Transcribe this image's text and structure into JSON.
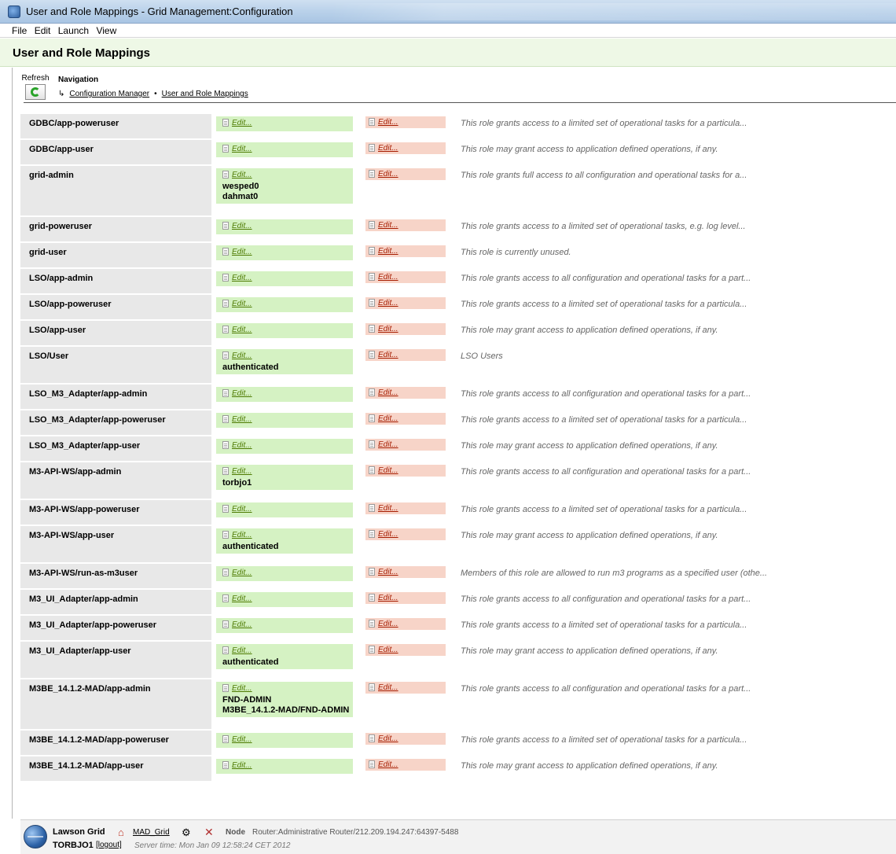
{
  "window": {
    "title": "User and Role Mappings - Grid Management:Configuration",
    "icon": "grid-app-icon"
  },
  "menu": [
    "File",
    "Edit",
    "Launch",
    "View"
  ],
  "header": {
    "title": "User and Role Mappings"
  },
  "toolbar": {
    "refresh_label": "Refresh",
    "refresh_icon": "refresh-icon"
  },
  "navigation": {
    "title": "Navigation",
    "arrow": "↳",
    "separator": "•",
    "crumbs": [
      "Configuration Manager",
      "User and Role Mappings"
    ]
  },
  "edit_label": "Edit...",
  "colors": {
    "users_bg": "#d5f2c3",
    "groups_bg": "#f7d4c8",
    "role_bg": "#e8e8e8",
    "header_bg": "#eef8e6"
  },
  "roles": [
    {
      "name": "GDBC/app-poweruser",
      "users": [],
      "desc": "This role grants access to a limited set of operational tasks for a particula..."
    },
    {
      "name": "GDBC/app-user",
      "users": [],
      "desc": "This role may grant access to application defined operations, if any."
    },
    {
      "name": "grid-admin",
      "users": [
        "wesped0",
        "dahmat0"
      ],
      "desc": "This role grants full access to all configuration and operational tasks for a..."
    },
    {
      "name": "grid-poweruser",
      "users": [],
      "desc": "This role grants access to a limited set of operational tasks, e.g. log level..."
    },
    {
      "name": "grid-user",
      "users": [],
      "desc": "This role is currently unused."
    },
    {
      "name": "LSO/app-admin",
      "users": [],
      "desc": "This role grants access to all configuration and operational tasks for a part..."
    },
    {
      "name": "LSO/app-poweruser",
      "users": [],
      "desc": "This role grants access to a limited set of operational tasks for a particula..."
    },
    {
      "name": "LSO/app-user",
      "users": [],
      "desc": "This role may grant access to application defined operations, if any."
    },
    {
      "name": "LSO/User",
      "users": [
        "authenticated"
      ],
      "desc": "LSO Users"
    },
    {
      "name": "LSO_M3_Adapter/app-admin",
      "users": [],
      "desc": "This role grants access to all configuration and operational tasks for a part..."
    },
    {
      "name": "LSO_M3_Adapter/app-poweruser",
      "users": [],
      "desc": "This role grants access to a limited set of operational tasks for a particula..."
    },
    {
      "name": "LSO_M3_Adapter/app-user",
      "users": [],
      "desc": "This role may grant access to application defined operations, if any."
    },
    {
      "name": "M3-API-WS/app-admin",
      "users": [
        "torbjo1"
      ],
      "desc": "This role grants access to all configuration and operational tasks for a part..."
    },
    {
      "name": "M3-API-WS/app-poweruser",
      "users": [],
      "desc": "This role grants access to a limited set of operational tasks for a particula..."
    },
    {
      "name": "M3-API-WS/app-user",
      "users": [
        "authenticated"
      ],
      "desc": "This role may grant access to application defined operations, if any."
    },
    {
      "name": "M3-API-WS/run-as-m3user",
      "users": [],
      "desc": "Members of this role are allowed to run m3 programs as a specified user (othe..."
    },
    {
      "name": "M3_UI_Adapter/app-admin",
      "users": [],
      "desc": "This role grants access to all configuration and operational tasks for a part..."
    },
    {
      "name": "M3_UI_Adapter/app-poweruser",
      "users": [],
      "desc": "This role grants access to a limited set of operational tasks for a particula..."
    },
    {
      "name": "M3_UI_Adapter/app-user",
      "users": [
        "authenticated"
      ],
      "desc": "This role may grant access to application defined operations, if any."
    },
    {
      "name": "M3BE_14.1.2-MAD/app-admin",
      "users": [
        "FND-ADMIN",
        "M3BE_14.1.2-MAD/FND-ADMIN"
      ],
      "desc": "This role grants access to all configuration and operational tasks for a part..."
    },
    {
      "name": "M3BE_14.1.2-MAD/app-poweruser",
      "users": [],
      "desc": "This role grants access to a limited set of operational tasks for a particula..."
    },
    {
      "name": "M3BE_14.1.2-MAD/app-user",
      "users": [],
      "desc": "This role may grant access to application defined operations, if any."
    }
  ],
  "footer": {
    "brand": "Lawson Grid",
    "user": "TORBJO1",
    "logout": "[logout]",
    "grid_link": "MAD_Grid",
    "node_label": "Node",
    "node_value": "Router:Administrative Router/212.209.194.247:64397-5488",
    "server_time": "Server time: Mon Jan 09 12:58:24 CET 2012"
  }
}
